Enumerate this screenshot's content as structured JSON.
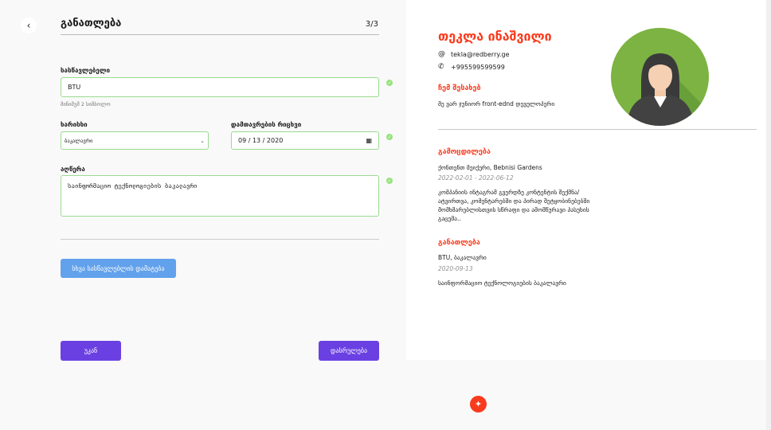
{
  "header": {
    "title": "განათლება",
    "step": "3/3",
    "back_icon": "chevron-left-icon"
  },
  "form": {
    "institution": {
      "label": "სასწავლებელი",
      "value": "BTU",
      "hint": "მინიმუმ 2 სიმბოლო"
    },
    "degree": {
      "label": "ხარისხი",
      "value": "ბაკალავრი"
    },
    "due_date": {
      "label": "დამთავრების რიცხვი",
      "value": "09 / 13 / 2020"
    },
    "description": {
      "label": "აღწერა",
      "value": "საინფორმაციო ტექნოლოგიების ბაკალავრი"
    },
    "add_button": "სხვა სასწავლებლის დამატება",
    "back_button": "უკან",
    "finish_button": "დასრულება"
  },
  "cv": {
    "name": "თეკლა ინაშვილი",
    "email": "tekla@redberry.ge",
    "phone": "+995599599599",
    "about_title": "ჩემ შესახებ",
    "about_text": "მე ვარ ჯუნიორ front-ednd დეველოპერი",
    "experience_title": "გამოცდილება",
    "experience_position": "ქონთენთ მეიქერი, Bebnisi Gardens",
    "experience_dates": "2022-02-01 - 2022-06-12",
    "experience_desc": "კომპანიის ინტაგრამ გვერდზე კონტენტის შექმნა/ ატვირთვა, კომენტარებში და პირად შეტყობინებებში მომხმარებლისთვის სწრაფი და ამომწურავი პასუხის გაცემა..",
    "education_title": "განათლება",
    "education_school": "BTU, ბაკალავრი",
    "education_date": "2020-09-13",
    "education_desc": "საინფორმაციო ტექნოლოგიების ბაკალავრი"
  },
  "colors": {
    "accent": "#f93b1d",
    "primary_button": "#6b40e3",
    "secondary_button": "#62a1eb",
    "valid": "#98e37e"
  }
}
